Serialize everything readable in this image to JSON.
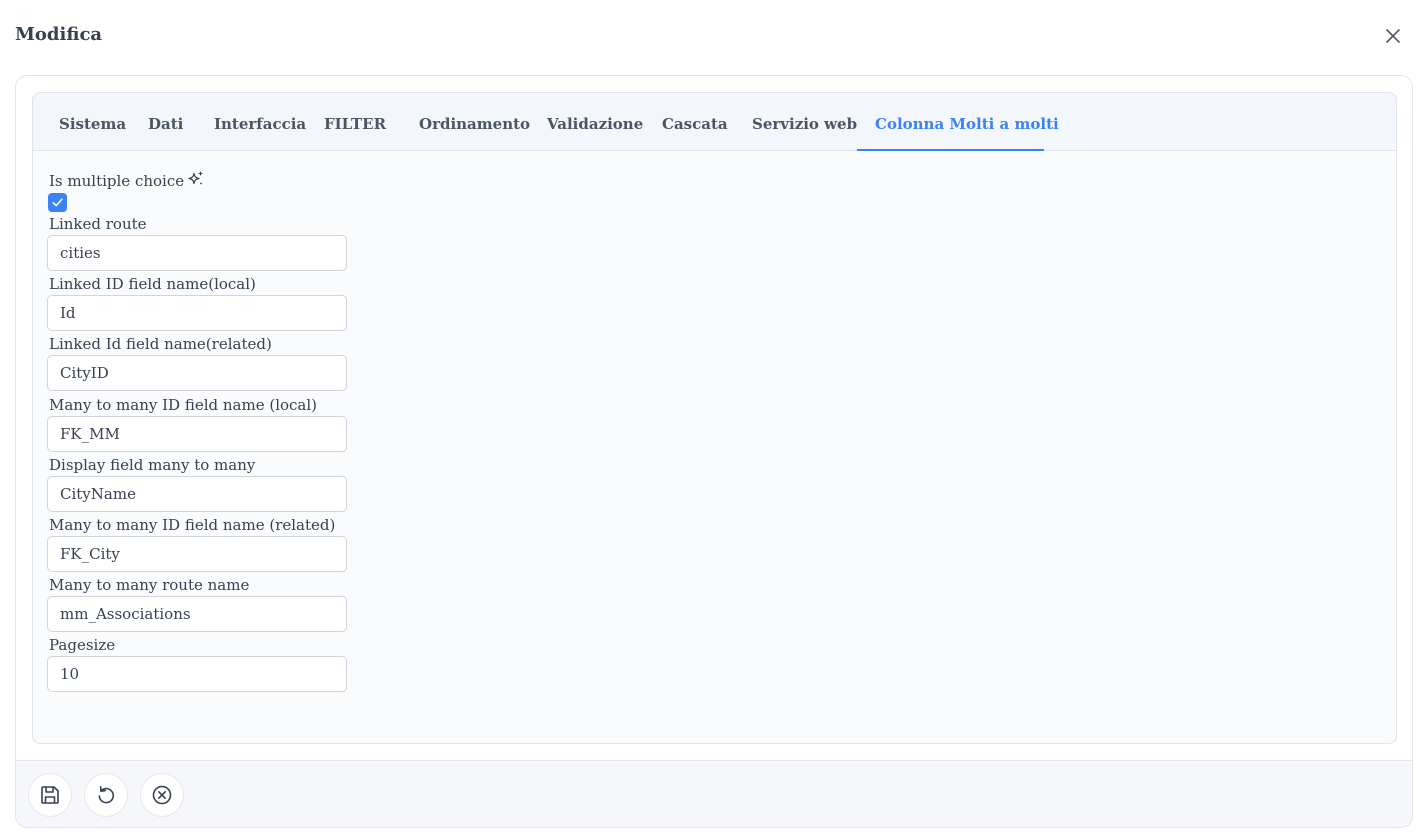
{
  "dialog": {
    "title": "Modifica"
  },
  "tabs": [
    {
      "label": "Sistema"
    },
    {
      "label": "Dati"
    },
    {
      "label": "Interfaccia"
    },
    {
      "label": "FILTER"
    },
    {
      "label": "Ordinamento"
    },
    {
      "label": "Validazione"
    },
    {
      "label": "Cascata"
    },
    {
      "label": "Servizio web"
    },
    {
      "label": "Colonna Molti a molti"
    }
  ],
  "active_tab": "Colonna Molti a molti",
  "form": {
    "multiple_choice": {
      "label": "Is multiple choice",
      "checked": true
    },
    "fields": [
      {
        "label": "Linked route",
        "value": "cities"
      },
      {
        "label": "Linked ID field name(local)",
        "value": "Id"
      },
      {
        "label": "Linked Id field name(related)",
        "value": "CityID"
      },
      {
        "label": "Many to many ID field name (local)",
        "value": "FK_MM"
      },
      {
        "label": "Display field many to many",
        "value": "CityName"
      },
      {
        "label": "Many to many ID field name (related)",
        "value": "FK_City"
      },
      {
        "label": "Many to many route name",
        "value": "mm_Associations"
      },
      {
        "label": "Pagesize",
        "value": "10"
      }
    ]
  },
  "icons": {
    "close": "close-icon",
    "sparkle": "sparkle-icon",
    "check": "check-icon",
    "save": "save-icon",
    "reset": "reset-icon",
    "cancel": "cancel-icon"
  },
  "colors": {
    "accent": "#3b82f6",
    "text": "#374151",
    "tab_text": "#4b5563"
  }
}
